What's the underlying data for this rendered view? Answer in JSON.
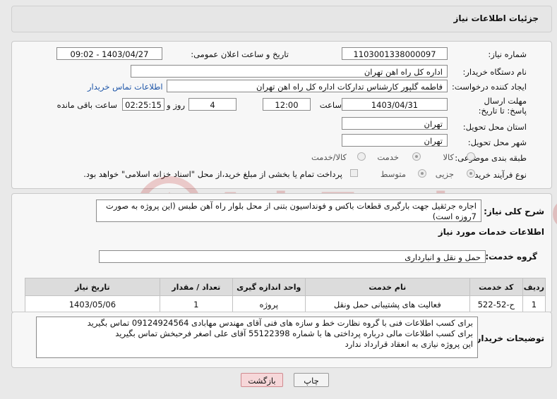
{
  "header": {
    "title": "جزئیات اطلاعات نیاز"
  },
  "form": {
    "need_number_label": "شماره نیاز:",
    "need_number": "1103001338000097",
    "announce_label": "تاریخ و ساعت اعلان عمومی:",
    "announce_value": "1403/04/27 - 09:02",
    "buyer_org_label": "نام دستگاه خریدار:",
    "buyer_org": "اداره کل راه اهن تهران",
    "creator_label": "ایجاد کننده درخواست:",
    "creator": "فاطمه گلپور کارشناس تدارکات اداره کل راه اهن تهران",
    "contact_link": "اطلاعات تماس خریدار",
    "deadline_label": "مهلت ارسال پاسخ: تا تاریخ:",
    "deadline_date": "1403/04/31",
    "time_label": "ساعت",
    "deadline_time": "12:00",
    "days_value": "4",
    "days_label": "روز و",
    "remaining_time": "02:25:15",
    "remaining_label": "ساعت باقی مانده",
    "province_label": "استان محل تحویل:",
    "province": "تهران",
    "city_label": "شهر محل تحویل:",
    "city": "تهران",
    "category_label": "طبقه بندی موضوعی:",
    "category_options": [
      "کالا",
      "خدمت",
      "کالا/خدمت"
    ],
    "category_selected": "خدمت",
    "process_label": "نوع فرآیند خرید :",
    "process_options": [
      "جزیی",
      "متوسط"
    ],
    "process_selected": "جزیی",
    "payment_note": "پرداخت تمام یا بخشی از مبلغ خرید،از محل \"اسناد خزانه اسلامی\" خواهد بود."
  },
  "summary": {
    "label": "شرح کلی نیاز:",
    "text": "اجاره جرثقیل جهت بارگیری قطعات باکس و فونداسیون بتنی از محل بلوار راه آهن طبس (این پروژه به صورت 7روزه است)"
  },
  "services": {
    "section_title": "اطلاعات خدمات مورد نیاز",
    "group_label": "گروه خدمت:",
    "group_value": "حمل و نقل و انبارداری",
    "columns": [
      "ردیف",
      "کد خدمت",
      "نام خدمت",
      "واحد اندازه گیری",
      "تعداد / مقدار",
      "تاریخ نیاز"
    ],
    "rows": [
      [
        "1",
        "ح-52-522",
        "فعالیت های پشتیبانی حمل ونقل",
        "پروژه",
        "1",
        "1403/05/06"
      ]
    ]
  },
  "buyer_notes": {
    "label": "توضیحات خریدار:",
    "lines": [
      "برای کسب اطلاعات فنی با گروه نظارت خط و سازه های فنی آقای مهندس مهابادی 09124924564 تماس بگیرید",
      "برای کسب اطلاعات مالی درباره پرداختی ها با شماره 55122398 آقای علی اصغر فرحبخش تماس بگیرید",
      "این پروژه نیازی به انعقاد قرارداد ندارد"
    ]
  },
  "buttons": {
    "print": "چاپ",
    "back": "بازگشت"
  },
  "watermark": {
    "text": "AriaTender.neT"
  },
  "colors": {
    "link": "#1f56a8",
    "back_button_bg": "#f6d7d9",
    "back_button_border": "#d08a8f"
  }
}
